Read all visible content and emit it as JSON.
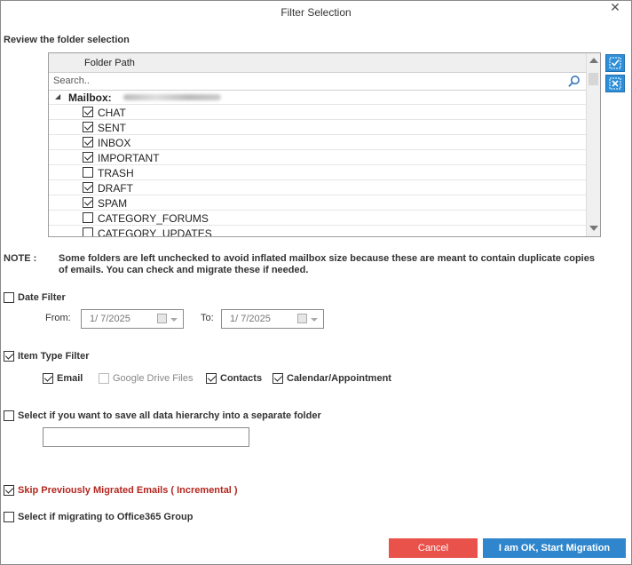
{
  "window": {
    "title": "Filter Selection",
    "close_glyph": "✕"
  },
  "folder_section": {
    "title": "Review the folder selection",
    "column_header": "Folder Path",
    "search_placeholder": "Search..",
    "mailbox_label": "Mailbox:",
    "folders": [
      {
        "name": "CHAT",
        "checked": true
      },
      {
        "name": "SENT",
        "checked": true
      },
      {
        "name": "INBOX",
        "checked": true
      },
      {
        "name": "IMPORTANT",
        "checked": true
      },
      {
        "name": "TRASH",
        "checked": false
      },
      {
        "name": "DRAFT",
        "checked": true
      },
      {
        "name": "SPAM",
        "checked": true
      },
      {
        "name": "CATEGORY_FORUMS",
        "checked": false
      },
      {
        "name": "CATEGORY_UPDATES",
        "checked": false
      }
    ]
  },
  "note": {
    "label": "NOTE :",
    "text": "Some folders are left unchecked to avoid inflated mailbox size because these are meant to contain duplicate copies of emails. You can check and migrate these if needed."
  },
  "date_filter": {
    "label": "Date Filter",
    "checked": false,
    "from_label": "From:",
    "from_value": "1/  7/2025",
    "to_label": "To:",
    "to_value": "1/  7/2025"
  },
  "item_type_filter": {
    "label": "Item Type Filter",
    "checked": true,
    "items": {
      "email": {
        "label": "Email",
        "checked": true
      },
      "gdrive": {
        "label": "Google Drive Files",
        "checked": false,
        "disabled": true
      },
      "contacts": {
        "label": "Contacts",
        "checked": true
      },
      "calendar": {
        "label": "Calendar/Appointment",
        "checked": true
      }
    }
  },
  "hierarchy": {
    "label": "Select if you want to save all data hierarchy into a separate folder",
    "checked": false,
    "folder_name_value": ""
  },
  "incremental": {
    "label": "Skip Previously Migrated Emails ( Incremental )",
    "checked": true
  },
  "office365_group": {
    "label": "Select if migrating to Office365 Group",
    "checked": false
  },
  "buttons": {
    "cancel": "Cancel",
    "ok": "I am OK, Start Migration"
  },
  "colors": {
    "accent": "#2f86cc",
    "cancel": "#e8524b",
    "incremental_text": "#b3261e"
  }
}
